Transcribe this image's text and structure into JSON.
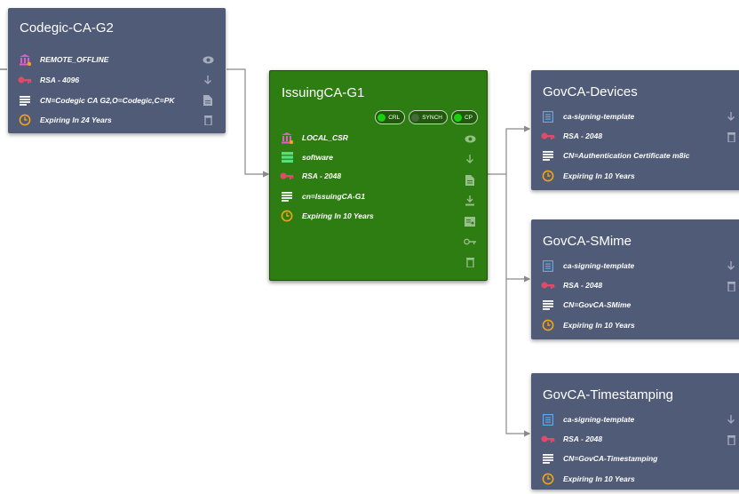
{
  "colors": {
    "card_bg": "#4f5b77",
    "selected_card_bg": "#2e7d12",
    "connector": "#8a8a8a",
    "key_icon": "#e04b6a",
    "clock_icon": "#f2a316",
    "bank_icon": "#e05fc6",
    "template_icon": "#5fa7e8",
    "status_on": "#1bd10f"
  },
  "nodes": {
    "root": {
      "title": "Codegic-CA-G2",
      "rows": [
        {
          "icon": "bank-icon",
          "text": "REMOTE_OFFLINE"
        },
        {
          "icon": "key-icon",
          "text": "RSA - 4096"
        },
        {
          "icon": "lines-icon",
          "text": "CN=Codegic CA G2,O=Codegic,C=PK"
        },
        {
          "icon": "clock-icon",
          "text": "Expiring In 24 Years"
        }
      ],
      "actions": [
        "eye-icon",
        "download-arrow-icon",
        "document-icon",
        "trash-icon"
      ]
    },
    "issuing": {
      "title": "IssuingCA-G1",
      "status_pills": [
        {
          "label": "CRL",
          "active": true
        },
        {
          "label": "SYNCH",
          "active": false
        },
        {
          "label": "CP",
          "active": true
        }
      ],
      "rows": [
        {
          "icon": "bank-icon",
          "text": "LOCAL_CSR"
        },
        {
          "icon": "storage-icon",
          "text": "software"
        },
        {
          "icon": "key-icon",
          "text": "RSA - 2048"
        },
        {
          "icon": "lines-icon",
          "text": "cn=IssuingCA-G1"
        },
        {
          "icon": "clock-icon",
          "text": "Expiring In 10 Years"
        }
      ],
      "actions": [
        "eye-icon",
        "download-arrow-icon",
        "document-icon",
        "export-icon",
        "certificate-icon",
        "key-icon",
        "trash-icon"
      ]
    },
    "devices": {
      "title": "GovCA-Devices",
      "rows": [
        {
          "icon": "template-icon",
          "text": "ca-signing-template"
        },
        {
          "icon": "key-icon",
          "text": "RSA - 2048"
        },
        {
          "icon": "lines-icon",
          "text": "CN=Authentication Certificate m8ic"
        },
        {
          "icon": "clock-icon",
          "text": "Expiring In 10 Years"
        }
      ],
      "actions": [
        "download-arrow-icon",
        "trash-icon"
      ]
    },
    "smime": {
      "title": "GovCA-SMime",
      "rows": [
        {
          "icon": "template-icon",
          "text": "ca-signing-template"
        },
        {
          "icon": "key-icon",
          "text": "RSA - 2048"
        },
        {
          "icon": "lines-icon",
          "text": "CN=GovCA-SMime"
        },
        {
          "icon": "clock-icon",
          "text": "Expiring In 10 Years"
        }
      ],
      "actions": [
        "download-arrow-icon",
        "trash-icon"
      ]
    },
    "timestamping": {
      "title": "GovCA-Timestamping",
      "rows": [
        {
          "icon": "template-icon",
          "text": "ca-signing-template"
        },
        {
          "icon": "key-icon",
          "text": "RSA - 2048"
        },
        {
          "icon": "lines-icon",
          "text": "CN=GovCA-Timestamping"
        },
        {
          "icon": "clock-icon",
          "text": "Expiring In 10 Years"
        }
      ],
      "actions": [
        "download-arrow-icon",
        "trash-icon"
      ]
    }
  }
}
